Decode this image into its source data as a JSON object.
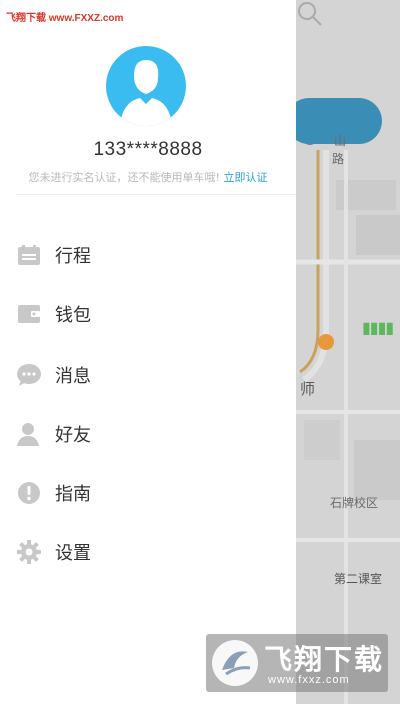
{
  "watermark": {
    "top_text": "飞翔下载 www.FXXZ.com",
    "brand": "飞翔下载",
    "url": "www.fxxz.com"
  },
  "profile": {
    "phone": "133****8888",
    "verify_notice": "您未进行实名认证，还不能使用单车哦!",
    "verify_link": "立即认证"
  },
  "menu": [
    {
      "label": "行程",
      "icon": "calendar-icon"
    },
    {
      "label": "钱包",
      "icon": "wallet-icon"
    },
    {
      "label": "消息",
      "icon": "chat-bubble-icon"
    },
    {
      "label": "好友",
      "icon": "friend-icon"
    },
    {
      "label": "指南",
      "icon": "exclamation-icon"
    },
    {
      "label": "设置",
      "icon": "gear-icon"
    }
  ],
  "map": {
    "labels": [
      "山",
      "路",
      "师",
      "石牌校区",
      "第二课室"
    ]
  },
  "colors": {
    "accent": "#3bbcf1",
    "link": "#26a2dc",
    "icon_gray": "#c8c8c8"
  }
}
